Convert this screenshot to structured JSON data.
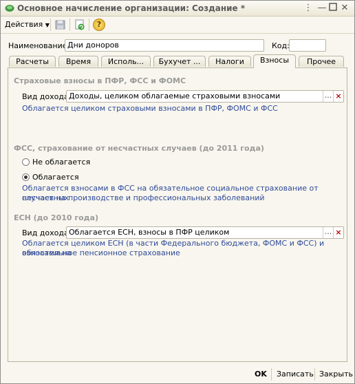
{
  "window": {
    "title": "Основное начисление организации: Создание *"
  },
  "toolbar": {
    "actions_label": "Действия",
    "help_label": "?"
  },
  "form": {
    "name_label": "Наименование:",
    "name_value": "Дни доноров",
    "code_label": "Код:",
    "code_value": ""
  },
  "tabs": [
    "Расчеты",
    "Время",
    "Исполь...",
    "Бухучет ...",
    "Налоги",
    "Взносы",
    "Прочее"
  ],
  "active_tab": "Взносы",
  "sections": {
    "pfr": {
      "title": "Страховые взносы в ПФР, ФСС и ФОМС",
      "income_label": "Вид дохода:",
      "income_value": "Доходы, целиком облагаемые страховыми взносами",
      "note": "Облагается целиком страховыми взносами в ПФР, ФОМС и ФСС"
    },
    "fss": {
      "title": "ФСС, страхование от несчастных случаев (до 2011 года)",
      "option1": "Не облагается",
      "option2": "Облагается",
      "selected": "Облагается",
      "note_line1": "Облагается взносами в ФСС на обязательное социальное страхование от несчастных",
      "note_line2": "случаев на производстве и профессиональных заболеваний"
    },
    "esn": {
      "title": "ЕСН (до 2010 года)",
      "income_label": "Вид дохода:",
      "income_value": "Облагается ЕСН, взносы в ПФР целиком",
      "note_line1": "Облагается целиком ЕСН (в части Федерального бюджета, ФОМС и ФСС) и взносами на",
      "note_line2": "обязательное пенсионное страхование"
    }
  },
  "select_buttons": {
    "dots": "...",
    "clear": "×"
  },
  "footer": {
    "ok": "OK",
    "save": "Записать",
    "close": "Закрыть"
  }
}
